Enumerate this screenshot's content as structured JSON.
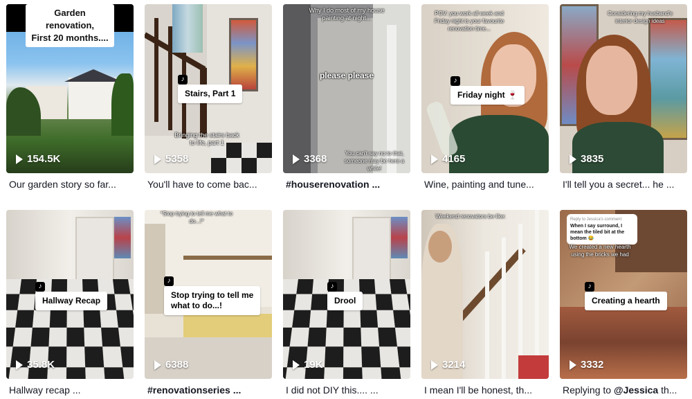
{
  "videos": [
    {
      "views": "154.5K",
      "caption": "Our garden story so far...",
      "overlay": "Garden renovation,\nFirst 20 months...."
    },
    {
      "views": "5358",
      "caption": "You'll have to come bac...",
      "banner": "Stairs, Part 1",
      "subtext": "Bringing the stairs back to life, part 1"
    },
    {
      "views": "3368",
      "caption": "#houserenovation ...",
      "top": "Why I do most of my house painting at night...",
      "mid": "please please",
      "bottom": "You can't say no to that, someone may be here a while!"
    },
    {
      "views": "4165",
      "caption": "Wine, painting and tune...",
      "top": "POV: you work all week and Friday night is your favourite renovation time...",
      "banner": "Friday night 🍷"
    },
    {
      "views": "3835",
      "caption": "I'll tell you a secret... he ...",
      "top": "Considering my husband's interior design ideas"
    },
    {
      "views": "35.8K",
      "caption": "Hallway recap ...",
      "banner": "Hallway Recap"
    },
    {
      "views": "6388",
      "caption": "#renovationseries ...",
      "top": "*Stop trying to tell me what to do...!*",
      "banner": "Stop trying to tell me\nwhat to do...!"
    },
    {
      "views": "19K",
      "caption": "I did not DIY this.... ...",
      "banner": "Drool"
    },
    {
      "views": "3214",
      "caption": "I mean I'll be honest, th...",
      "top": "Weekend renovators be like:"
    },
    {
      "views": "3332",
      "caption_prefix": "Replying to ",
      "caption_mention": "@Jessica",
      "caption_suffix": " th...",
      "reply_title": "Reply to Jessica's comment",
      "reply_text": "When I say surround, I mean the tiled bit at the bottom 😂",
      "overlay": "We created a new hearth using the bricks we had",
      "banner": "Creating a hearth"
    }
  ]
}
